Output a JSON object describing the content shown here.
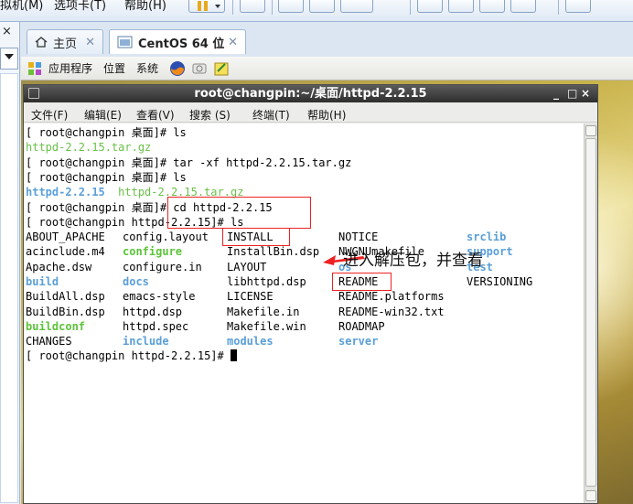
{
  "vmware_menubar": {
    "items": [
      "拟机(M)",
      "选项卡(T)",
      "帮助(H)"
    ]
  },
  "tabs": [
    {
      "label": "主页",
      "icon": "home-icon",
      "active": false
    },
    {
      "label": "CentOS 64 位",
      "icon": "vm-icon",
      "active": true
    }
  ],
  "gnome_panel": {
    "items": [
      "应用程序",
      "位置",
      "系统"
    ]
  },
  "terminal": {
    "title": "root@changpin:~/桌面/httpd-2.2.15",
    "window_controls": [
      "_",
      "□",
      "×"
    ],
    "menu": [
      "文件(F)",
      "编辑(E)",
      "查看(V)",
      "搜索 (S)",
      "终端(T)",
      "帮助(H)"
    ],
    "lines": [
      "[ root@changpin 桌面]# ls",
      "httpd-2.2.15.tar.gz",
      "[ root@changpin 桌面]# tar -xf httpd-2.2.15.tar.gz",
      "[ root@changpin 桌面]# ls",
      "",
      "[ root@changpin 桌面]# cd httpd-2.2.15",
      "[ root@changpin httpd-2.2.15]# ls"
    ],
    "ls_after_extract": [
      "httpd-2.2.15",
      "httpd-2.2.15.tar.gz"
    ],
    "listing_columns": [
      [
        "ABOUT_APACHE",
        "acinclude.m4",
        "Apache.dsw",
        "build",
        "BuildAll.dsp",
        "BuildBin.dsp",
        "buildconf",
        "CHANGES"
      ],
      [
        "config.layout",
        "configure",
        "configure.in",
        "docs",
        "emacs-style",
        "httpd.dsp",
        "httpd.spec",
        "include"
      ],
      [
        "INSTALL",
        "InstallBin.dsp",
        "LAYOUT",
        "libhttpd.dsp",
        "LICENSE",
        "Makefile.in",
        "Makefile.win",
        "modules"
      ],
      [
        "NOTICE",
        "NWGNUmakefile",
        "os",
        "README",
        "README.platforms",
        "README-win32.txt",
        "ROADMAP",
        "server"
      ],
      [
        "srclib",
        "support",
        "test",
        "VERSIONING"
      ]
    ],
    "prompt_last": "[ root@changpin httpd-2.2.15]# ",
    "colors": {
      "green_file": "#69c048",
      "blue_dir": "#5a9fd8",
      "exec_green": "#5cc33a"
    }
  },
  "annotation": {
    "text": "进入解压包，并查看",
    "color": "#e22222"
  }
}
